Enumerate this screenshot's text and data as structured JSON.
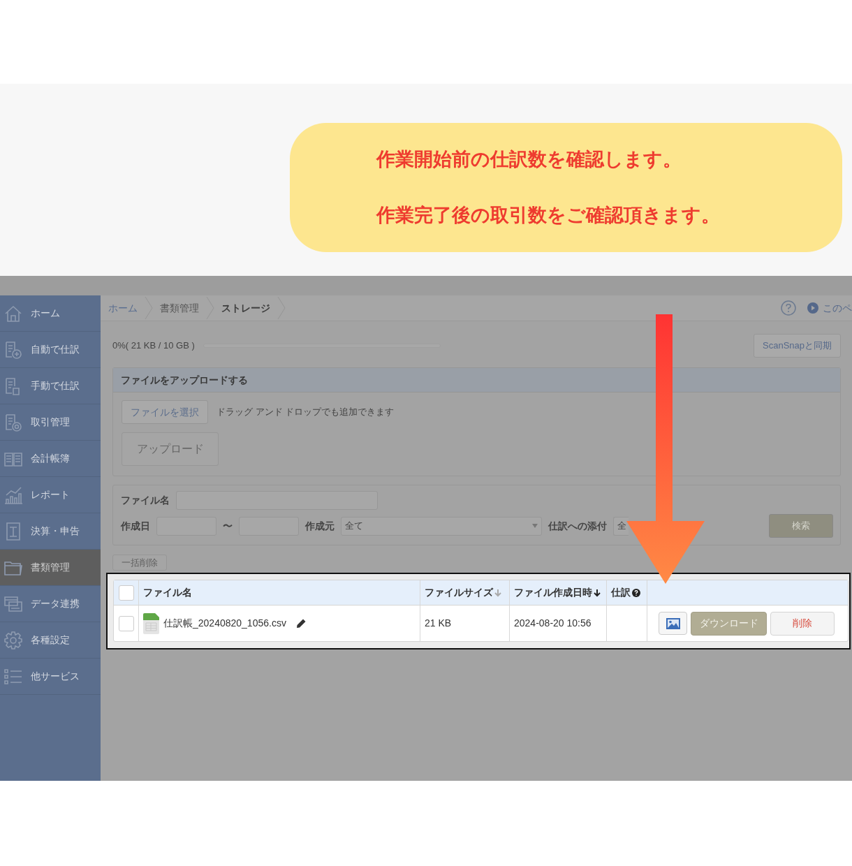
{
  "callout": {
    "lines": [
      "作業開始前の仕訳数を確認します。",
      "作業完了後の取引数をご確認頂きます。"
    ]
  },
  "sidebar": {
    "items": [
      {
        "label": "ホーム",
        "selected": false
      },
      {
        "label": "自動で仕訳",
        "selected": false
      },
      {
        "label": "手動で仕訳",
        "selected": false
      },
      {
        "label": "取引管理",
        "selected": false
      },
      {
        "label": "会計帳簿",
        "selected": false
      },
      {
        "label": "レポート",
        "selected": false
      },
      {
        "label": "決算・申告",
        "selected": false
      },
      {
        "label": "書類管理",
        "selected": true
      },
      {
        "label": "データ連携",
        "selected": false
      },
      {
        "label": "各種設定",
        "selected": false
      },
      {
        "label": "他サービス",
        "selected": false
      }
    ]
  },
  "breadcrumb": [
    {
      "label": "ホーム",
      "kind": "link"
    },
    {
      "label": "書類管理",
      "kind": "parent"
    },
    {
      "label": "ストレージ",
      "kind": "current"
    }
  ],
  "page_help_link": "このペ",
  "storage": {
    "text": "0%( 21 KB / 10 GB )"
  },
  "sync_button": "ScanSnapと同期",
  "upload_panel": {
    "title": "ファイルをアップロードする",
    "select_button": "ファイルを選択",
    "hint": "ドラッグ アンド ドロップでも追加できます",
    "upload_button": {
      "label": "アップロード",
      "disabled": true
    }
  },
  "search_panel": {
    "file_name_label": "ファイル名",
    "date_label": "作成日",
    "range_sep": "〜",
    "source_label": "作成元",
    "source_value": "全て",
    "attach_label": "仕訳への添付",
    "attach_value": "全",
    "search_button": "検索"
  },
  "bulk_delete_button": {
    "label": "一括削除",
    "disabled": true
  },
  "table": {
    "select_all": {
      "checked": false
    },
    "columns": [
      {
        "label": "ファイル名",
        "kind": "plain"
      },
      {
        "label": "ファイルサイズ",
        "kind": "sortable"
      },
      {
        "label": "ファイル作成日時",
        "kind": "sorted"
      },
      {
        "label": "仕訳",
        "kind": "help"
      }
    ],
    "rows": [
      {
        "checked": false,
        "file_name": "仕訳帳_20240820_1056.csv",
        "size": "21 KB",
        "created": "2024-08-20 10:56",
        "download": "ダウンロード",
        "delete": "削除"
      }
    ]
  }
}
